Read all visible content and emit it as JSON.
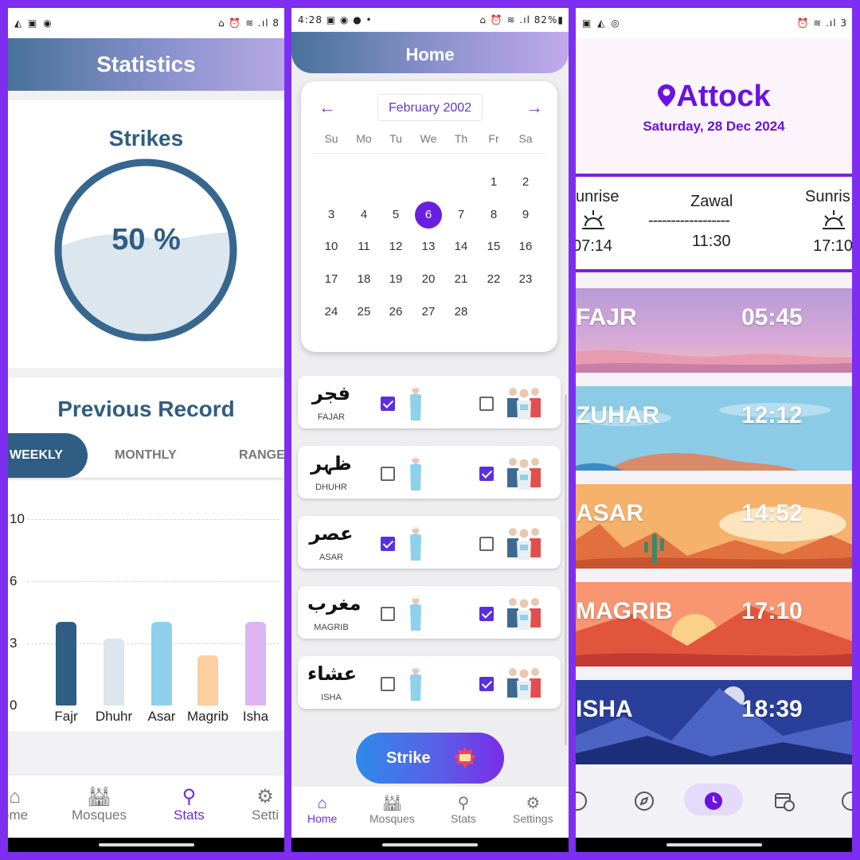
{
  "panel1": {
    "status_left": "◭ ▣ ◉",
    "status_right": "⌂ ⏰ ≋ .ıl 8",
    "title": "Statistics",
    "strikes_title": "Strikes",
    "strikes_percent": "50 %",
    "strikes_fill": 0.5,
    "previous_record": "Previous Record",
    "tabs": [
      "WEEKLY",
      "MONTHLY",
      "RANGE"
    ],
    "nav": [
      {
        "label": "ome",
        "icon": "home-icon"
      },
      {
        "label": "Mosques",
        "icon": "mosque-icon"
      },
      {
        "label": "Stats",
        "icon": "stats-icon"
      },
      {
        "label": "Setti",
        "icon": "settings-icon"
      }
    ],
    "chart_data": {
      "type": "bar",
      "categories": [
        "Fajr",
        "Dhuhr",
        "Asar",
        "Magrib",
        "Isha"
      ],
      "values": [
        4.5,
        3.6,
        4.5,
        2.7,
        4.5
      ],
      "colors": [
        "#2f5d83",
        "#dbe6ee",
        "#8ed0ea",
        "#fbcf9f",
        "#deb4f1"
      ],
      "yticks": [
        "10",
        "6",
        "3",
        "0"
      ],
      "ylim": [
        0,
        10
      ]
    }
  },
  "panel2": {
    "status_left": "4:28 ▣ ◉ ● •",
    "status_right": "⌂ ⏰ ≋ .ıl 82%▮",
    "title": "Home",
    "month": "February 2002",
    "weekdays": [
      "Su",
      "Mo",
      "Tu",
      "We",
      "Th",
      "Fr",
      "Sa"
    ],
    "days": [
      "1",
      "2",
      "3",
      "4",
      "5",
      "6",
      "7",
      "8",
      "9",
      "10",
      "11",
      "12",
      "13",
      "14",
      "15",
      "16",
      "17",
      "18",
      "19",
      "20",
      "21",
      "22",
      "23",
      "24",
      "25",
      "26",
      "27",
      "28"
    ],
    "selected_day": "6",
    "prayers": [
      {
        "ar": "فجر",
        "en": "FAJAR",
        "alone": true,
        "jamaat": false
      },
      {
        "ar": "ظہر",
        "en": "DHUHR",
        "alone": false,
        "jamaat": true
      },
      {
        "ar": "عصر",
        "en": "ASAR",
        "alone": true,
        "jamaat": false
      },
      {
        "ar": "مغرب",
        "en": "MAGRIB",
        "alone": false,
        "jamaat": true
      },
      {
        "ar": "عشاء",
        "en": "ISHA",
        "alone": false,
        "jamaat": true
      }
    ],
    "strike_button": "Strike",
    "nav": [
      "Home",
      "Mosques",
      "Stats",
      "Settings"
    ]
  },
  "panel3": {
    "status_left": "▣ ◭ ◎",
    "status_right": "⏰ ≋ .ıl 3",
    "city": "Attock",
    "date": "Saturday, 28 Dec 2024",
    "sunrise_label": "unrise",
    "sunrise_time": "07:14",
    "zawal_label": "Zawal",
    "zawal_dash": "------------------",
    "zawal_time": "11:30",
    "sunset_label": "Sunris",
    "sunset_time": "17:10",
    "prayers": [
      {
        "name": "FAJR",
        "time": "05:45"
      },
      {
        "name": "ZUHAR",
        "time": "12:12"
      },
      {
        "name": "ASAR",
        "time": "14:52"
      },
      {
        "name": "MAGRIB",
        "time": "17:10"
      },
      {
        "name": "ISHA",
        "time": "18:39"
      }
    ]
  }
}
